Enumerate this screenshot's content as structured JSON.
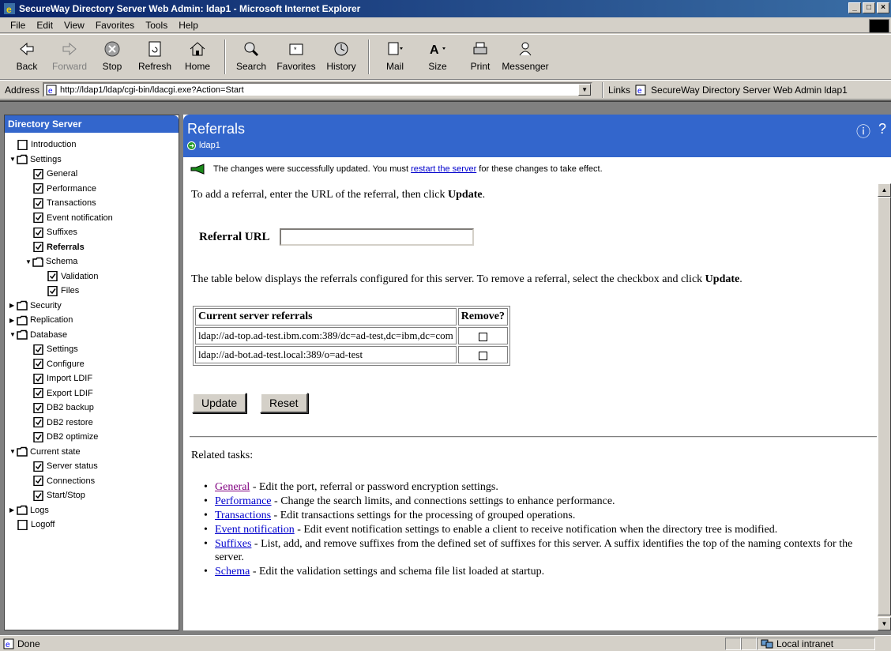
{
  "window": {
    "title": "SecureWay Directory Server Web Admin: ldap1 - Microsoft Internet Explorer",
    "controls": [
      "_",
      "□",
      "×"
    ]
  },
  "menu": [
    "File",
    "Edit",
    "View",
    "Favorites",
    "Tools",
    "Help"
  ],
  "toolbar": {
    "back": "Back",
    "forward": "Forward",
    "stop": "Stop",
    "refresh": "Refresh",
    "home": "Home",
    "search": "Search",
    "favorites": "Favorites",
    "history": "History",
    "mail": "Mail",
    "size": "Size",
    "print": "Print",
    "messenger": "Messenger"
  },
  "address": {
    "label": "Address",
    "url": "http://ldap1/ldap/cgi-bin/ldacgi.exe?Action=Start",
    "links_label": "Links",
    "link_item": "SecureWay Directory Server Web Admin ldap1"
  },
  "nav": {
    "header": "Directory Server",
    "items": [
      {
        "label": "Introduction"
      },
      {
        "label": "Settings"
      },
      {
        "label": "General"
      },
      {
        "label": "Performance"
      },
      {
        "label": "Transactions"
      },
      {
        "label": "Event notification"
      },
      {
        "label": "Suffixes"
      },
      {
        "label": "Referrals"
      },
      {
        "label": "Schema"
      },
      {
        "label": "Validation"
      },
      {
        "label": "Files"
      },
      {
        "label": "Security"
      },
      {
        "label": "Replication"
      },
      {
        "label": "Database"
      },
      {
        "label": "Settings"
      },
      {
        "label": "Configure"
      },
      {
        "label": "Import LDIF"
      },
      {
        "label": "Export LDIF"
      },
      {
        "label": "DB2 backup"
      },
      {
        "label": "DB2 restore"
      },
      {
        "label": "DB2 optimize"
      },
      {
        "label": "Current state"
      },
      {
        "label": "Server status"
      },
      {
        "label": "Connections"
      },
      {
        "label": "Start/Stop"
      },
      {
        "label": "Logs"
      },
      {
        "label": "Logoff"
      }
    ]
  },
  "main": {
    "title": "Referrals",
    "server": "ldap1",
    "message_before": "The changes were successfully updated. You must ",
    "message_link": "restart the server",
    "message_after": " for these changes to take effect.",
    "intro_before": "To add a referral, enter the URL of the referral, then click ",
    "intro_bold": "Update",
    "intro_after": ".",
    "referral_url_label": "Referral URL",
    "referral_url_value": "",
    "table_desc_before": "The table below displays the referrals configured for this server. To remove a referral, select the checkbox and click ",
    "table_desc_bold": "Update",
    "table_desc_after": ".",
    "table": {
      "headers": [
        "Current server referrals",
        "Remove?"
      ],
      "rows": [
        "ldap://ad-top.ad-test.ibm.com:389/dc=ad-test,dc=ibm,dc=com",
        "ldap://ad-bot.ad-test.local:389/o=ad-test"
      ]
    },
    "update_button": "Update",
    "reset_button": "Reset",
    "related_heading": "Related tasks:",
    "related": [
      {
        "link": "General",
        "desc": " - Edit the port, referral or password encryption settings."
      },
      {
        "link": "Performance",
        "desc": " - Change the search limits, and connections settings to enhance performance."
      },
      {
        "link": "Transactions",
        "desc": " - Edit transactions settings for the processing of grouped operations."
      },
      {
        "link": "Event notification",
        "desc": " - Edit event notification settings to enable a client to receive notification when the directory tree is modified."
      },
      {
        "link": "Suffixes",
        "desc": " - List, add, and remove suffixes from the defined set of suffixes for this server. A suffix identifies the top of the naming contexts for the server."
      },
      {
        "link": "Schema",
        "desc": " - Edit the validation settings and schema file list loaded at startup."
      }
    ]
  },
  "status": {
    "text": "Done",
    "zone": "Local intranet"
  },
  "colors": {
    "header_blue": "#3366cc",
    "link": "#0000cc",
    "visited": "#800080"
  }
}
